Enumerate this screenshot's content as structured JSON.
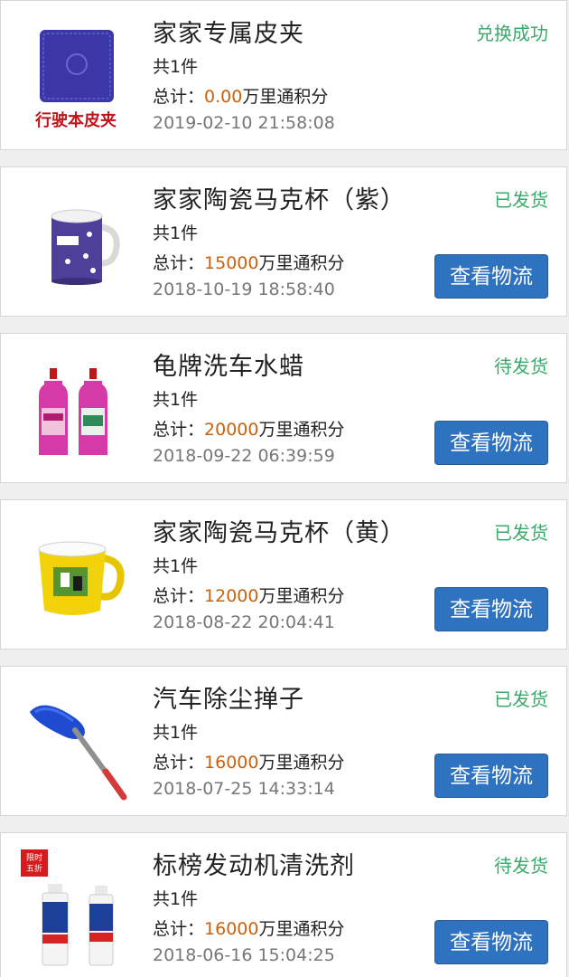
{
  "orders": [
    {
      "title": "家家专属皮夹",
      "qty": "共1件",
      "total_prefix": "总计：",
      "amount": "0.00",
      "unit": "万里通积分",
      "date": "2019-02-10 21:58:08",
      "status": "兑换成功",
      "image_caption": "行驶本皮夹"
    },
    {
      "title": "家家陶瓷马克杯（紫）",
      "qty": "共1件",
      "total_prefix": "总计：",
      "amount": "15000",
      "unit": "万里通积分",
      "date": "2018-10-19 18:58:40",
      "status": "已发货",
      "button": "查看物流"
    },
    {
      "title": "龟牌洗车水蜡",
      "qty": "共1件",
      "total_prefix": "总计：",
      "amount": "20000",
      "unit": "万里通积分",
      "date": "2018-09-22 06:39:59",
      "status": "待发货",
      "button": "查看物流"
    },
    {
      "title": "家家陶瓷马克杯（黄）",
      "qty": "共1件",
      "total_prefix": "总计：",
      "amount": "12000",
      "unit": "万里通积分",
      "date": "2018-08-22 20:04:41",
      "status": "已发货",
      "button": "查看物流"
    },
    {
      "title": "汽车除尘掸子",
      "qty": "共1件",
      "total_prefix": "总计：",
      "amount": "16000",
      "unit": "万里通积分",
      "date": "2018-07-25 14:33:14",
      "status": "已发货",
      "button": "查看物流"
    },
    {
      "title": "标榜发动机清洗剂",
      "qty": "共1件",
      "total_prefix": "总计：",
      "amount": "16000",
      "unit": "万里通积分",
      "date": "2018-06-16 15:04:25",
      "status": "待发货",
      "button": "查看物流",
      "badge": "限时\n五折"
    }
  ],
  "colors": {
    "status": "#3aaa6c",
    "amount": "#c8620c",
    "button": "#2f73c0"
  }
}
